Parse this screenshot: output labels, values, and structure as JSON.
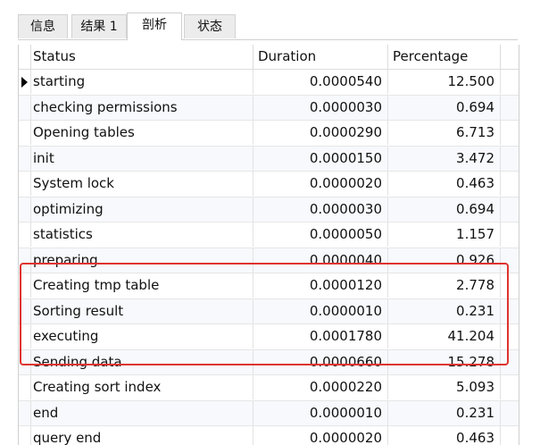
{
  "tabs": [
    {
      "label": "信息"
    },
    {
      "label": "结果 1"
    },
    {
      "label": "剖析"
    },
    {
      "label": "状态"
    }
  ],
  "active_tab": "剖析",
  "columns": [
    "Status",
    "Duration",
    "Percentage"
  ],
  "rows": [
    {
      "status": "starting",
      "duration": "0.0000540",
      "percentage": "12.500"
    },
    {
      "status": "checking permissions",
      "duration": "0.0000030",
      "percentage": "0.694"
    },
    {
      "status": "Opening tables",
      "duration": "0.0000290",
      "percentage": "6.713"
    },
    {
      "status": "init",
      "duration": "0.0000150",
      "percentage": "3.472"
    },
    {
      "status": "System lock",
      "duration": "0.0000020",
      "percentage": "0.463"
    },
    {
      "status": "optimizing",
      "duration": "0.0000030",
      "percentage": "0.694"
    },
    {
      "status": "statistics",
      "duration": "0.0000050",
      "percentage": "1.157"
    },
    {
      "status": "preparing",
      "duration": "0.0000040",
      "percentage": "0.926"
    },
    {
      "status": "Creating tmp table",
      "duration": "0.0000120",
      "percentage": "2.778"
    },
    {
      "status": "Sorting result",
      "duration": "0.0000010",
      "percentage": "0.231"
    },
    {
      "status": "executing",
      "duration": "0.0001780",
      "percentage": "41.204"
    },
    {
      "status": "Sending data",
      "duration": "0.0000660",
      "percentage": "15.278"
    },
    {
      "status": "Creating sort index",
      "duration": "0.0000220",
      "percentage": "5.093"
    },
    {
      "status": "end",
      "duration": "0.0000010",
      "percentage": "0.231"
    },
    {
      "status": "query end",
      "duration": "0.0000020",
      "percentage": "0.463"
    }
  ],
  "current_row": "starting",
  "highlighted_rows": [
    "Creating tmp table",
    "Sorting result",
    "executing",
    "Sending data"
  ],
  "colors": {
    "highlight_border": "#e0332f"
  }
}
